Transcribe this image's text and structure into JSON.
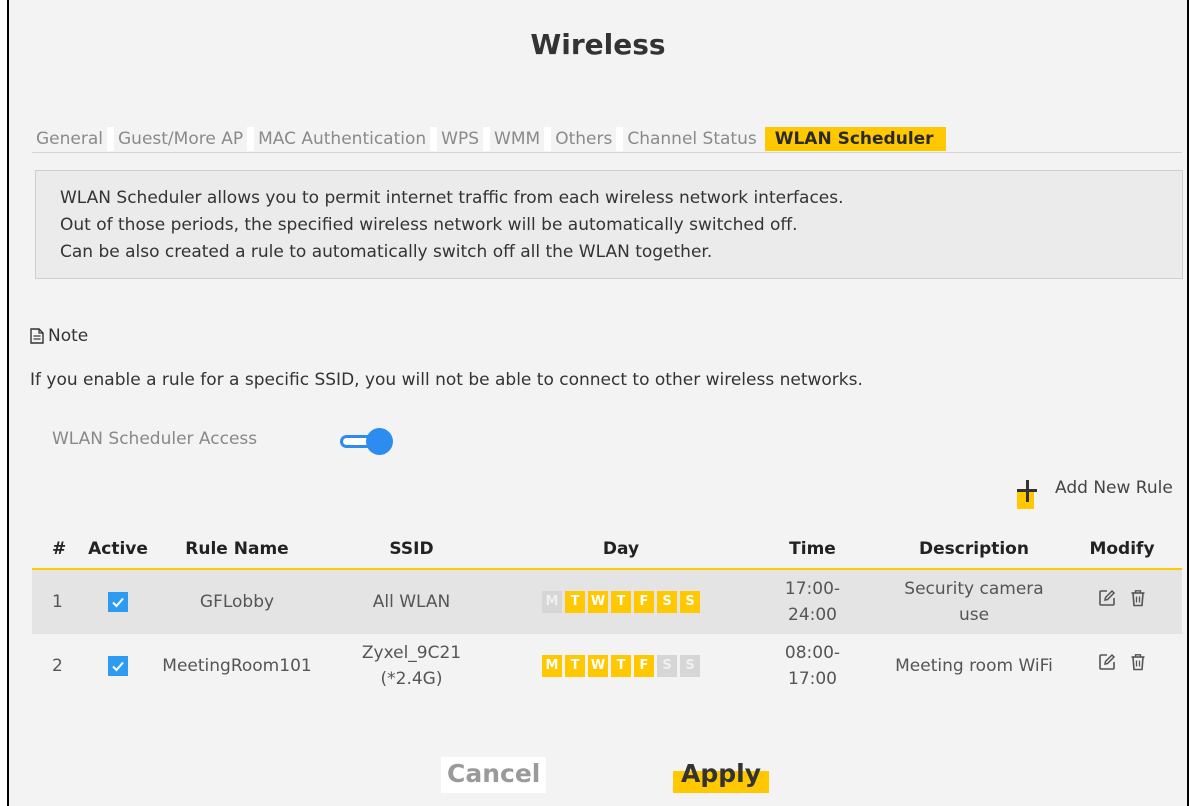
{
  "page": {
    "title": "Wireless"
  },
  "tabs": [
    {
      "label": "General",
      "active": false
    },
    {
      "label": "Guest/More AP",
      "active": false
    },
    {
      "label": "MAC Authentication",
      "active": false
    },
    {
      "label": "WPS",
      "active": false
    },
    {
      "label": "WMM",
      "active": false
    },
    {
      "label": "Others",
      "active": false
    },
    {
      "label": "Channel Status",
      "active": false
    },
    {
      "label": "WLAN Scheduler",
      "active": true
    }
  ],
  "info": {
    "line1": "WLAN Scheduler allows you to permit internet traffic from each wireless network interfaces.",
    "line2": "Out of those periods, the specified wireless network will be automatically switched off.",
    "line3": "Can be also created a rule to automatically switch off all the WLAN together."
  },
  "note": {
    "title": "Note",
    "text": "If you enable a rule for a specific SSID, you will not be able to connect to other wireless networks."
  },
  "access": {
    "label": "WLAN Scheduler Access",
    "enabled": true
  },
  "add_rule": {
    "label": "Add New Rule"
  },
  "table": {
    "headers": {
      "num": "#",
      "active": "Active",
      "name": "Rule Name",
      "ssid": "SSID",
      "day": "Day",
      "time": "Time",
      "desc": "Description",
      "modify": "Modify"
    },
    "rows": [
      {
        "num": "1",
        "active": true,
        "name": "GFLobby",
        "ssid_line1": "All WLAN",
        "ssid_line2": "",
        "days": [
          {
            "letter": "M",
            "on": false
          },
          {
            "letter": "T",
            "on": true
          },
          {
            "letter": "W",
            "on": true
          },
          {
            "letter": "T",
            "on": true
          },
          {
            "letter": "F",
            "on": true
          },
          {
            "letter": "S",
            "on": true
          },
          {
            "letter": "S",
            "on": true
          }
        ],
        "time_line1": "17:00-",
        "time_line2": "24:00",
        "desc_line1": "Security camera",
        "desc_line2": "use"
      },
      {
        "num": "2",
        "active": true,
        "name": "MeetingRoom101",
        "ssid_line1": "Zyxel_9C21",
        "ssid_line2": "(*2.4G)",
        "days": [
          {
            "letter": "M",
            "on": true
          },
          {
            "letter": "T",
            "on": true
          },
          {
            "letter": "W",
            "on": true
          },
          {
            "letter": "T",
            "on": true
          },
          {
            "letter": "F",
            "on": true
          },
          {
            "letter": "S",
            "on": false
          },
          {
            "letter": "S",
            "on": false
          }
        ],
        "time_line1": "08:00-",
        "time_line2": "17:00",
        "desc_line1": "Meeting room WiFi",
        "desc_line2": ""
      }
    ]
  },
  "buttons": {
    "cancel": "Cancel",
    "apply": "Apply"
  },
  "colors": {
    "accent": "#ffc800",
    "toggle": "#2d8cf0",
    "checkbox": "#2d9bf0"
  }
}
